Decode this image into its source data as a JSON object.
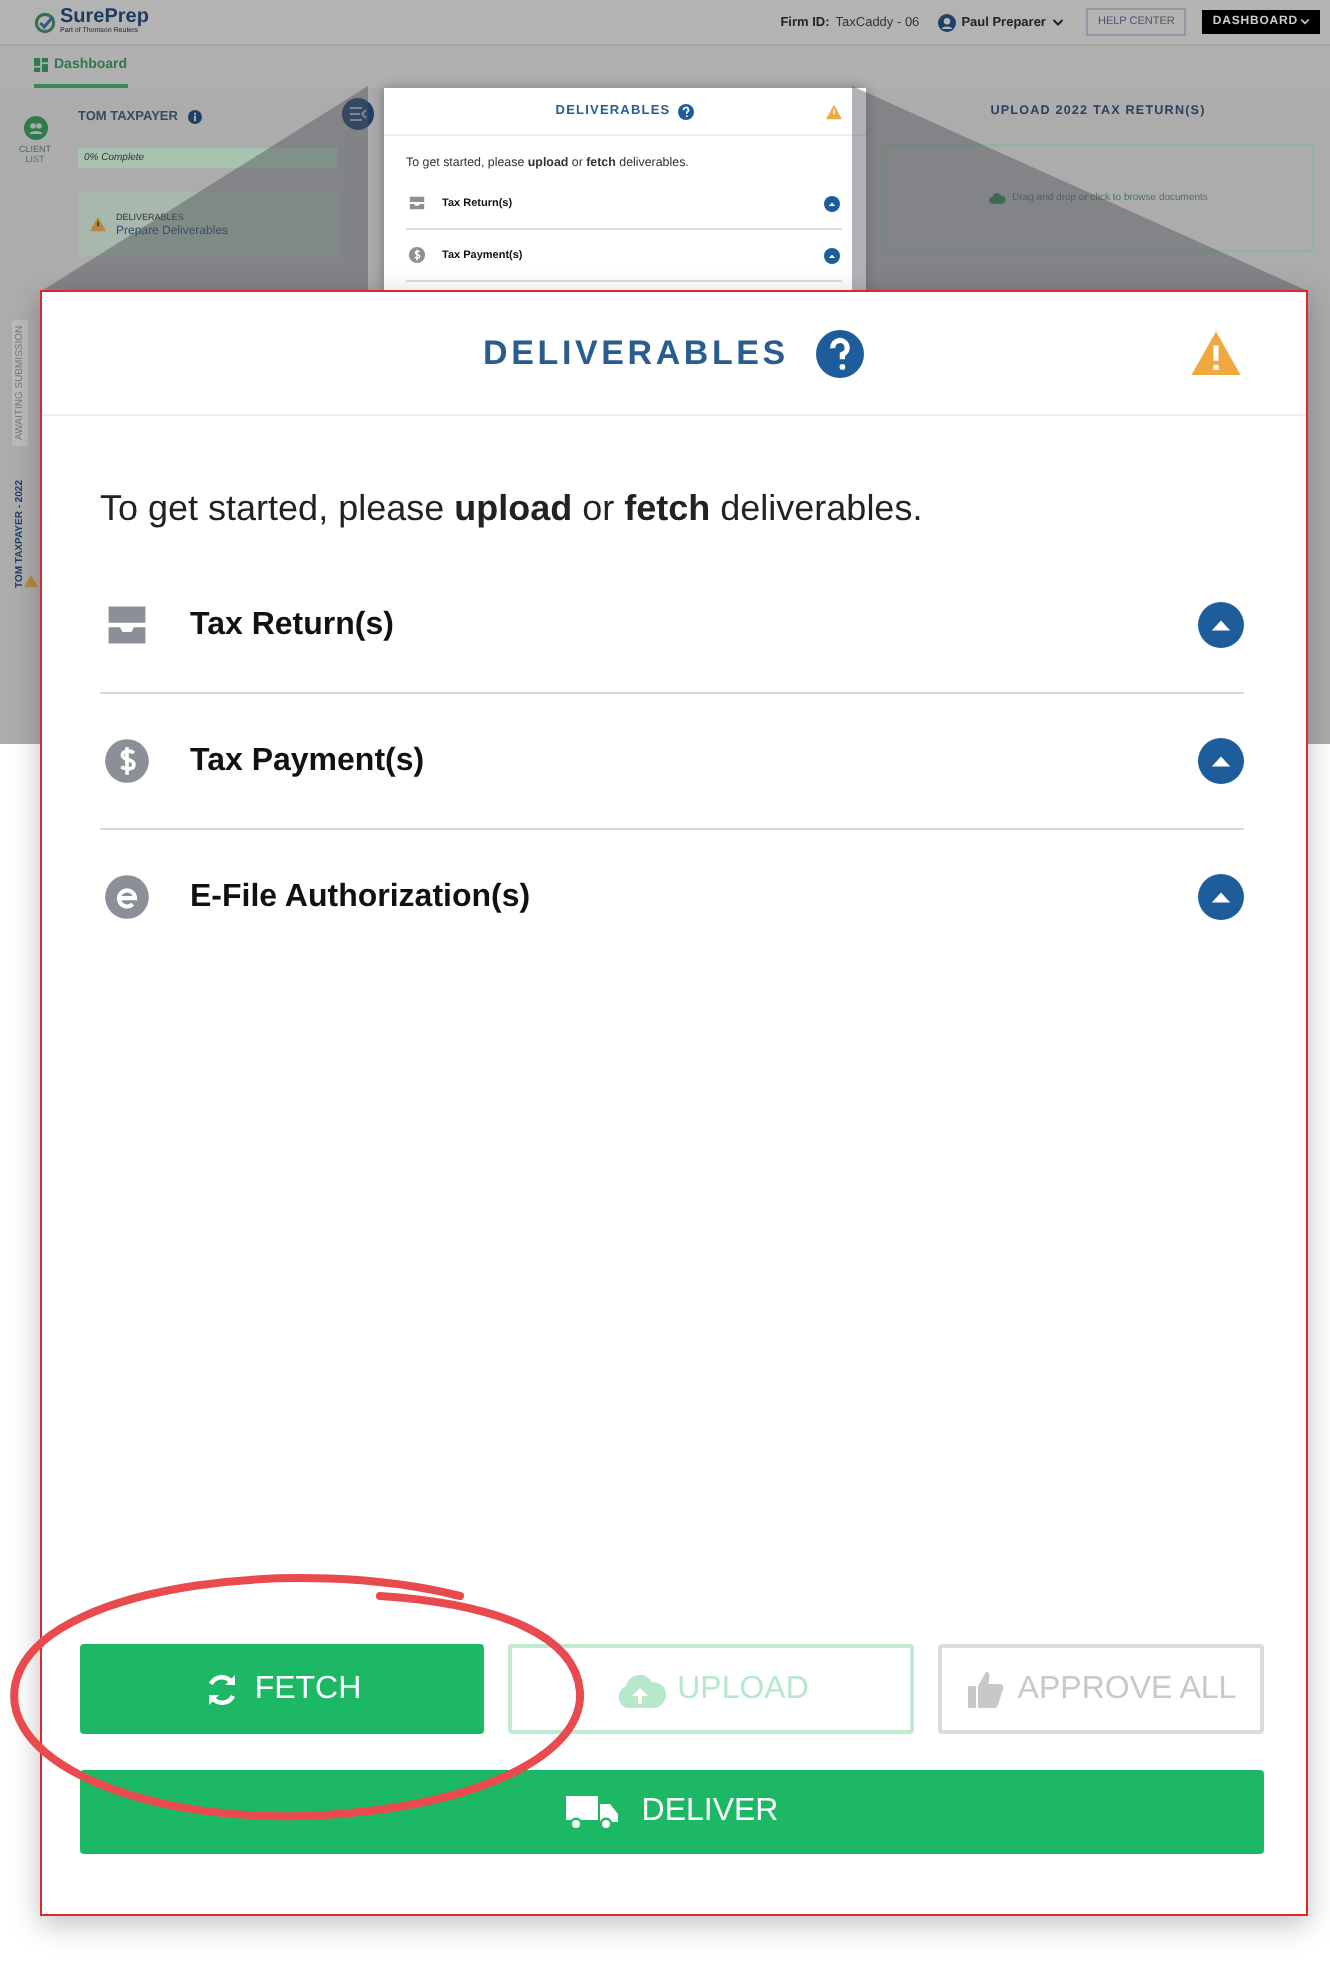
{
  "header": {
    "logo": "SurePrep",
    "logo_tagline": "Part of Thomson Reuters",
    "firm_id_label": "Firm ID:",
    "firm_id": "TaxCaddy - 06",
    "user": "Paul Preparer",
    "help_button": "HELP CENTER",
    "menu_button": "DASHBOARD"
  },
  "tabs": [
    {
      "label": "Dashboard",
      "selected": true
    }
  ],
  "rail": {
    "client_list": "CLIENT LIST"
  },
  "client": {
    "name": "TOM TAXPAYER",
    "progress_label": "0% Complete",
    "task_title": "DELIVERABLES",
    "task_link": "Prepare Deliverables",
    "vertical_tabs": [
      {
        "label": "AWAITING SUBMISSION",
        "selected": false
      },
      {
        "label": "TOM TAXPAYER - 2022",
        "selected": true
      }
    ]
  },
  "deliverables_popup": {
    "title": "DELIVERABLES",
    "intro": "To get started, please **upload** or **fetch** deliverables.",
    "items": [
      {
        "label": "Tax Return(s)",
        "kind": "tray"
      },
      {
        "label": "Tax Payment(s)",
        "kind": "payment"
      }
    ]
  },
  "upload": {
    "title": "UPLOAD 2022 TAX RETURN(S)",
    "dropzone": "Drag and drop or click to browse documents"
  },
  "callout": {
    "title": "DELIVERABLES",
    "intro": "To get started, please **upload** or **fetch** deliverables.",
    "items": [
      {
        "label": "Tax Return(s)",
        "kind": "tray"
      },
      {
        "label": "Tax Payment(s)",
        "kind": "payment"
      },
      {
        "label": "E-File Authorization(s)",
        "kind": "efile"
      }
    ],
    "buttons": [
      {
        "label": "FETCH",
        "kind": "fetch",
        "disabled": false
      },
      {
        "label": "UPLOAD",
        "kind": "upload",
        "disabled": true
      },
      {
        "label": "APPROVE ALL",
        "kind": "approve",
        "disabled": true
      }
    ],
    "deliver_button": "DELIVER"
  }
}
